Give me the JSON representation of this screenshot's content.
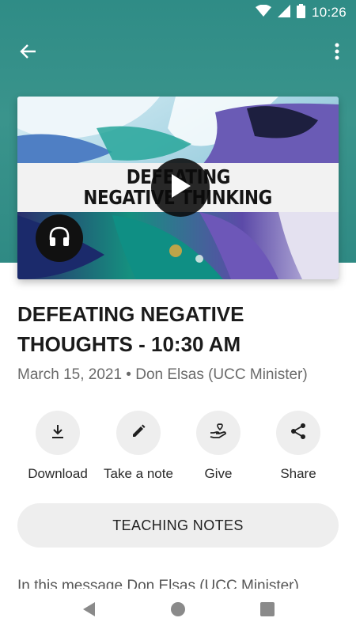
{
  "status_bar": {
    "time": "10:26",
    "icons": [
      "wifi-icon",
      "cell-signal-icon",
      "battery-icon"
    ]
  },
  "app_bar": {
    "back_icon": "arrow-back-icon",
    "more_icon": "more-vert-icon"
  },
  "artwork": {
    "banner_line1": "DEFEATING",
    "banner_line2": "NEGATIVE THINKING",
    "play_icon": "play-icon",
    "audio_icon": "headphones-icon"
  },
  "message": {
    "title": "DEFEATING NEGATIVE THOUGHTS - 10:30 AM",
    "meta": "March 15, 2021 • Don Elsas (UCC Minister)"
  },
  "actions": [
    {
      "label": "Download",
      "icon": "download-icon"
    },
    {
      "label": "Take a note",
      "icon": "pencil-icon"
    },
    {
      "label": "Give",
      "icon": "give-heart-hand-icon"
    },
    {
      "label": "Share",
      "icon": "share-icon"
    }
  ],
  "teaching_notes": {
    "label": "TEACHING NOTES"
  },
  "description": {
    "text": "In this message Don Elsas (UCC Minister)"
  },
  "colors": {
    "header": "#2f8c86",
    "button_bg": "#eeeeee"
  }
}
